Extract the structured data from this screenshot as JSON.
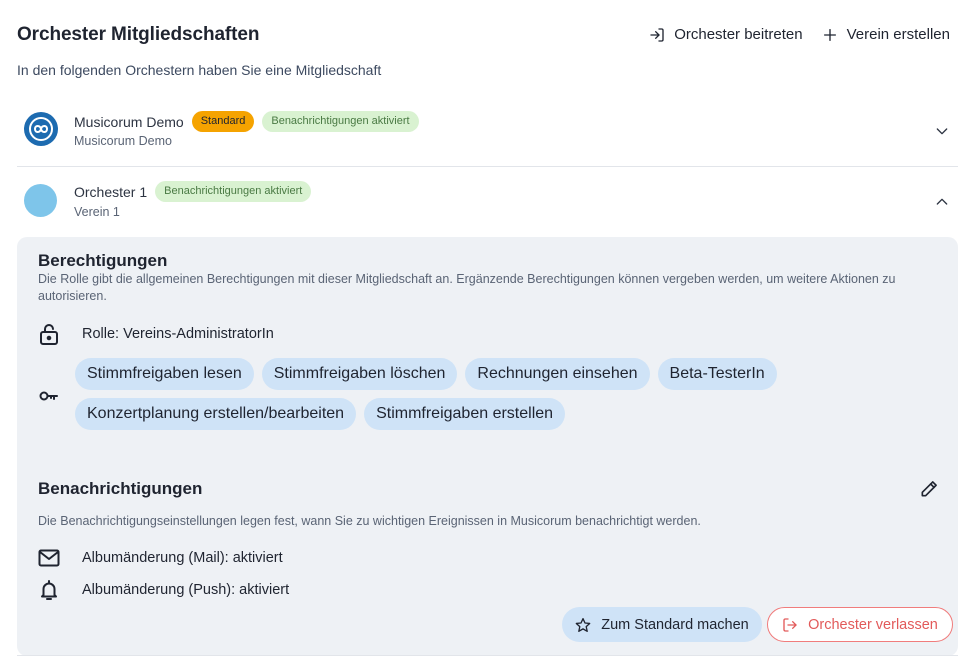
{
  "header": {
    "title": "Orchester Mitgliedschaften",
    "join_label": "Orchester beitreten",
    "create_label": "Verein erstellen"
  },
  "subtitle": "In den folgenden Orchestern haben Sie eine Mitgliedschaft",
  "memberships": [
    {
      "name": "Musicorum Demo",
      "association": "Musicorum Demo",
      "badges": [
        "Standard",
        "Benachrichtigungen aktiviert"
      ],
      "expanded": false
    },
    {
      "name": "Orchester 1",
      "association": "Verein 1",
      "badges": [
        "Benachrichtigungen aktiviert"
      ],
      "expanded": true
    }
  ],
  "permissions": {
    "title": "Berechtigungen",
    "description": "Die Rolle gibt die allgemeinen Berechtigungen mit dieser Mitgliedschaft an. Ergänzende Berechtigungen können vergeben werden, um weitere Aktionen zu autorisieren.",
    "role": "Rolle: Vereins-AdministratorIn",
    "extra": [
      "Stimmfreigaben lesen",
      "Stimmfreigaben löschen",
      "Rechnungen einsehen",
      "Beta-TesterIn",
      "Konzertplanung erstellen/bearbeiten",
      "Stimmfreigaben erstellen"
    ]
  },
  "notifications": {
    "title": "Benachrichtigungen",
    "description": "Die Benachrichtigungseinstellungen legen fest, wann Sie zu wichtigen Ereignissen in Musicorum benachrichtigt werden.",
    "mail": "Albumänderung (Mail): aktiviert",
    "push": "Albumänderung (Push): aktiviert"
  },
  "actions": {
    "make_standard": "Zum Standard machen",
    "leave": "Orchester verlassen"
  },
  "colors": {
    "standard_badge": "#f5a300",
    "notif_badge_bg": "#d9f2d1",
    "chip_bg": "#cfe3f7",
    "panel_bg": "#eef1f5",
    "danger": "#e25a5a"
  },
  "icons": [
    "login-icon",
    "plus-icon",
    "chevron-down-icon",
    "chevron-up-icon",
    "lock-open-icon",
    "key-icon",
    "pencil-icon",
    "mail-icon",
    "bell-icon",
    "star-icon",
    "logout-icon"
  ]
}
